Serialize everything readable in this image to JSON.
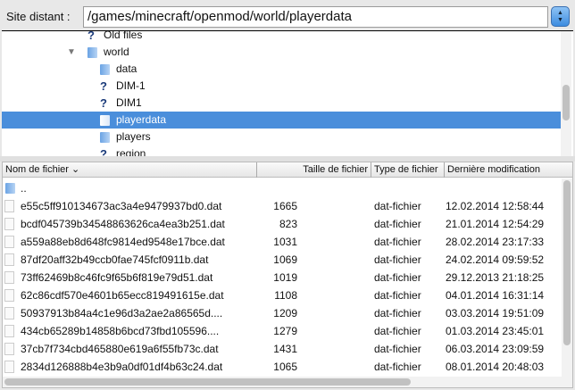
{
  "header": {
    "label": "Site distant :",
    "path": "/games/minecraft/openmod/world/playerdata"
  },
  "tree": [
    {
      "label": "Old files",
      "icon": "unknown",
      "level": 1
    },
    {
      "label": "world",
      "icon": "folder",
      "level": 1,
      "expanded": true
    },
    {
      "label": "data",
      "icon": "folder",
      "level": 2
    },
    {
      "label": "DIM-1",
      "icon": "unknown",
      "level": 2
    },
    {
      "label": "DIM1",
      "icon": "unknown",
      "level": 2
    },
    {
      "label": "playerdata",
      "icon": "folder-open",
      "level": 2,
      "selected": true
    },
    {
      "label": "players",
      "icon": "folder",
      "level": 2
    },
    {
      "label": "region",
      "icon": "unknown",
      "level": 2
    }
  ],
  "columns": {
    "name": "Nom de fichier",
    "size": "Taille de fichier",
    "type": "Type de fichier",
    "modified": "Dernière modification"
  },
  "parent": "..",
  "files": [
    {
      "name": "e55c5ff910134673ac3a4e9479937bd0.dat",
      "size": "1665",
      "type": "dat-fichier",
      "modified": "12.02.2014 12:58:44"
    },
    {
      "name": "bcdf045739b34548863626ca4ea3b251.dat",
      "size": "823",
      "type": "dat-fichier",
      "modified": "21.01.2014 12:54:29"
    },
    {
      "name": "a559a88eb8d648fc9814ed9548e17bce.dat",
      "size": "1031",
      "type": "dat-fichier",
      "modified": "28.02.2014 23:17:33"
    },
    {
      "name": "87df20aff32b49ccb0fae745fcf0911b.dat",
      "size": "1069",
      "type": "dat-fichier",
      "modified": "24.02.2014 09:59:52"
    },
    {
      "name": "73ff62469b8c46fc9f65b6f819e79d51.dat",
      "size": "1019",
      "type": "dat-fichier",
      "modified": "29.12.2013 21:18:25"
    },
    {
      "name": "62c86cdf570e4601b65ecc819491615e.dat",
      "size": "1108",
      "type": "dat-fichier",
      "modified": "04.01.2014 16:31:14"
    },
    {
      "name": "50937913b84a4c1e96d3a2ae2a86565d....",
      "size": "1209",
      "type": "dat-fichier",
      "modified": "03.03.2014 19:51:09"
    },
    {
      "name": "434cb65289b14858b6bcd73fbd105596....",
      "size": "1279",
      "type": "dat-fichier",
      "modified": "01.03.2014 23:45:01"
    },
    {
      "name": "37cb7f734cbd465880e619a6f55fb73c.dat",
      "size": "1431",
      "type": "dat-fichier",
      "modified": "06.03.2014 23:09:59"
    },
    {
      "name": "2834d126888b4e3b9a0df01df4b63c24.dat",
      "size": "1065",
      "type": "dat-fichier",
      "modified": "08.01.2014 20:48:03"
    }
  ]
}
